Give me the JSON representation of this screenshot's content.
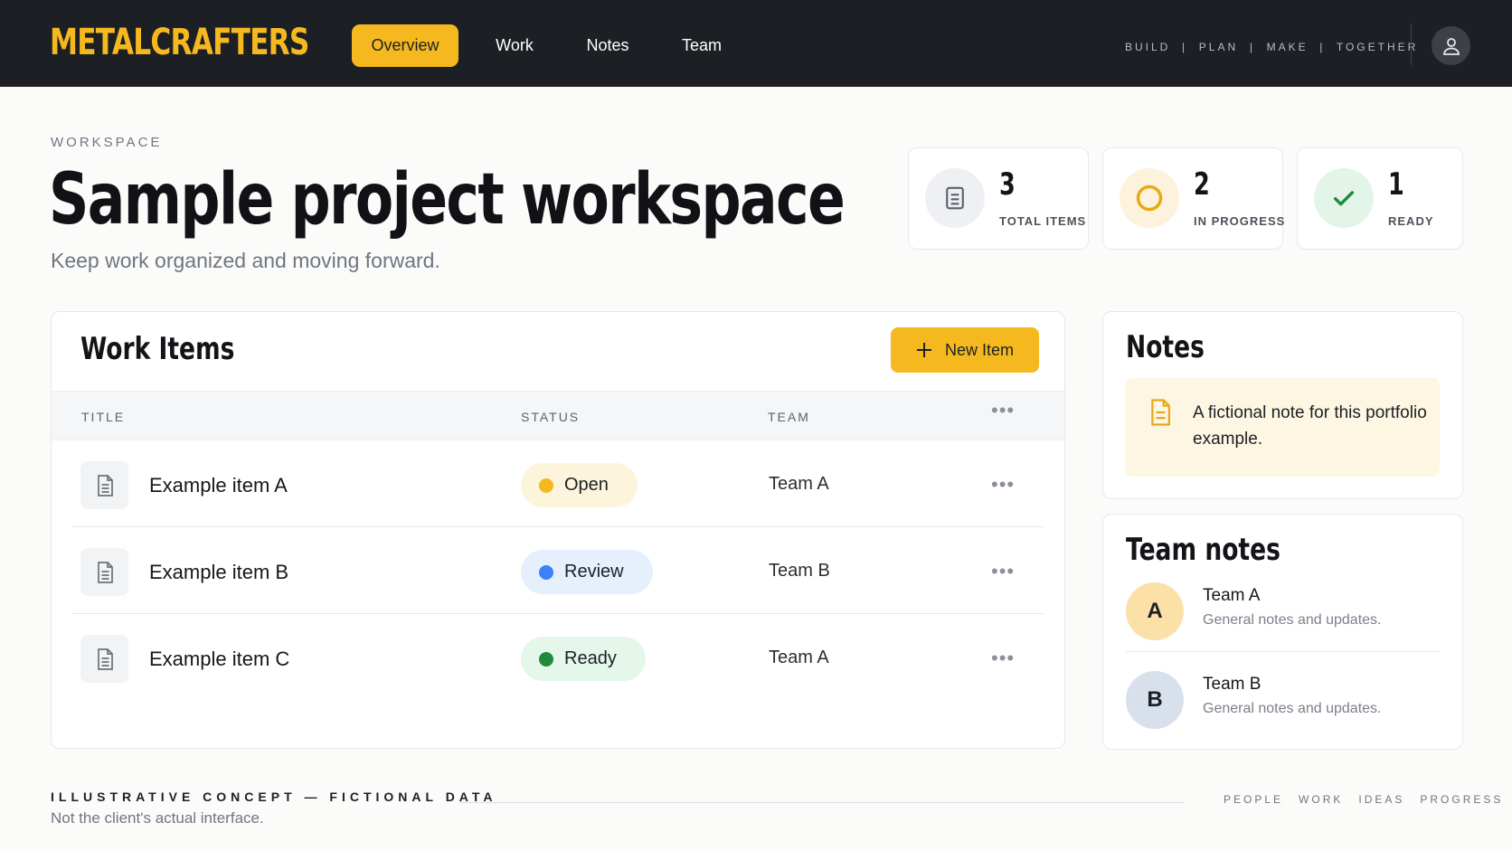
{
  "brand": "METALCRAFTERS",
  "nav": [
    {
      "label": "Overview",
      "active": true
    },
    {
      "label": "Work",
      "active": false
    },
    {
      "label": "Notes",
      "active": false
    },
    {
      "label": "Team",
      "active": false
    }
  ],
  "tagline": "BUILD  |  PLAN  |  MAKE  |  TOGETHER",
  "header": {
    "eyebrow": "WORKSPACE",
    "title": "Sample project workspace",
    "subtitle": "Keep work organized and moving forward."
  },
  "stats": [
    {
      "value": "3",
      "label": "TOTAL ITEMS",
      "icon": "document-icon"
    },
    {
      "value": "2",
      "label": "IN PROGRESS",
      "icon": "progress-circle-icon"
    },
    {
      "value": "1",
      "label": "READY",
      "icon": "checkmark-icon"
    }
  ],
  "work_items": {
    "title": "Work Items",
    "new_button": "New Item",
    "columns": {
      "title": "TITLE",
      "status": "STATUS",
      "team": "TEAM"
    },
    "rows": [
      {
        "title": "Example item A",
        "status": "Open",
        "status_color": "#f5b91f",
        "pill_bg": "#fdf4dc",
        "team": "Team A"
      },
      {
        "title": "Example item B",
        "status": "Review",
        "status_color": "#3b82f6",
        "pill_bg": "#e6f0fd",
        "team": "Team B"
      },
      {
        "title": "Example item C",
        "status": "Ready",
        "status_color": "#1f8a3c",
        "pill_bg": "#e5f6ea",
        "team": "Team A"
      }
    ]
  },
  "notes": {
    "title": "Notes",
    "text": "A fictional note for this portfolio example."
  },
  "team_notes": {
    "title": "Team notes",
    "items": [
      {
        "initial": "A",
        "name": "Team A",
        "sub": "General notes and updates.",
        "color": "#fbe0a8"
      },
      {
        "initial": "B",
        "name": "Team B",
        "sub": "General notes and updates.",
        "color": "#d8e0ec"
      }
    ]
  },
  "footer": {
    "title": "ILLUSTRATIVE CONCEPT — FICTIONAL DATA",
    "subtitle": "Not the client's actual interface.",
    "links": [
      "PEOPLE",
      "WORK",
      "IDEAS",
      "PROGRESS"
    ]
  },
  "colors": {
    "accent": "#f5b91f",
    "topbar": "#1c1f24"
  }
}
